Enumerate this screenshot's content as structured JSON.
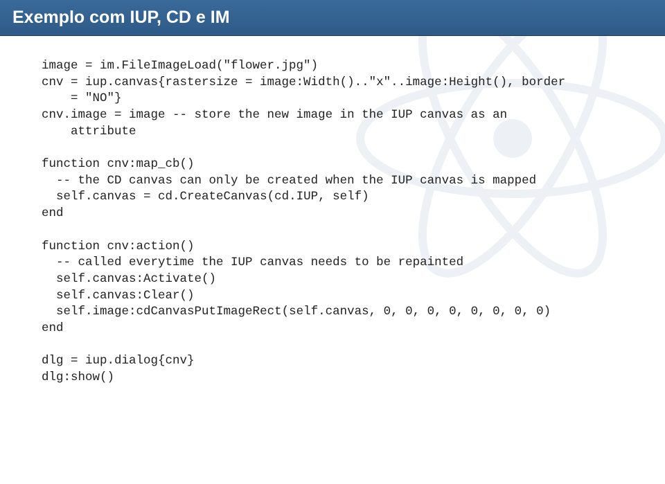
{
  "header": {
    "title": "Exemplo com IUP, CD e IM"
  },
  "code": {
    "block1": "image = im.FileImageLoad(\"flower.jpg\")\ncnv = iup.canvas{rastersize = image:Width()..\"x\"..image:Height(), border\n    = \"NO\"}\ncnv.image = image -- store the new image in the IUP canvas as an\n    attribute",
    "block2": "function cnv:map_cb()\n  -- the CD canvas can only be created when the IUP canvas is mapped\n  self.canvas = cd.CreateCanvas(cd.IUP, self)\nend",
    "block3": "function cnv:action()\n  -- called everytime the IUP canvas needs to be repainted\n  self.canvas:Activate()\n  self.canvas:Clear()\n  self.image:cdCanvasPutImageRect(self.canvas, 0, 0, 0, 0, 0, 0, 0, 0)\nend",
    "block4": "dlg = iup.dialog{cnv}\ndlg:show()"
  }
}
